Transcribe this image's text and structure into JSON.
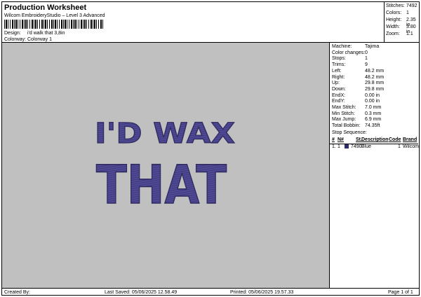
{
  "header": {
    "title": "Production Worksheet",
    "subtitle": "Wilcom EmbroideryStudio – Level 3 Advanced",
    "design_label": "Design:",
    "design_value": "i'd walk that 3,8in",
    "colorway_label": "Colorway:",
    "colorway_value": "Colorway 1"
  },
  "stats": [
    {
      "label": "Stitches:",
      "value": "7492"
    },
    {
      "label": "Colors:",
      "value": "1"
    },
    {
      "label": "Height:",
      "value": "2.35 in"
    },
    {
      "label": "Width:",
      "value": "3.80 in"
    },
    {
      "label": "Zoom:",
      "value": "1:1"
    }
  ],
  "design": {
    "line1": "I'D WAX",
    "line2": "THAT",
    "thread_color": "#4f4a93"
  },
  "info": [
    {
      "label": "Machine:",
      "value": "Tajima"
    },
    {
      "label": "Color changes:",
      "value": "0"
    },
    {
      "label": "Stops:",
      "value": "1"
    },
    {
      "label": "Trims:",
      "value": "9"
    },
    {
      "label": "Left:",
      "value": "48.2 mm"
    },
    {
      "label": "Right:",
      "value": "48.2 mm"
    },
    {
      "label": "Up:",
      "value": "29.8 mm"
    },
    {
      "label": "Down:",
      "value": "29.8 mm"
    },
    {
      "label": "EndX:",
      "value": "0.00 in"
    },
    {
      "label": "EndY:",
      "value": "0.00 in"
    },
    {
      "label": "Max Stitch:",
      "value": "7.0 mm"
    },
    {
      "label": "Min Stitch:",
      "value": "0.3 mm"
    },
    {
      "label": "Max Jump:",
      "value": "6.9 mm"
    },
    {
      "label": "Total Bobbin:",
      "value": "74.35ft"
    }
  ],
  "stop_sequence": {
    "heading": "Stop Sequence:",
    "columns": {
      "hash": "#",
      "n": "N#",
      "st": "St.",
      "desc": "Description",
      "code": "Code",
      "brand": "Brand"
    },
    "rows": [
      {
        "hash": "1.",
        "n": "1",
        "st": "7490",
        "desc": "Blue",
        "code": "1",
        "brand": "Wilcom",
        "swatch": "#2d2a6e"
      }
    ]
  },
  "footer": {
    "created": "Created By:",
    "saved": "Last Saved: 05/06/2025 12.58.49",
    "printed": "Printed: 05/06/2025 19.57.33",
    "page": "Page 1 of 1"
  }
}
